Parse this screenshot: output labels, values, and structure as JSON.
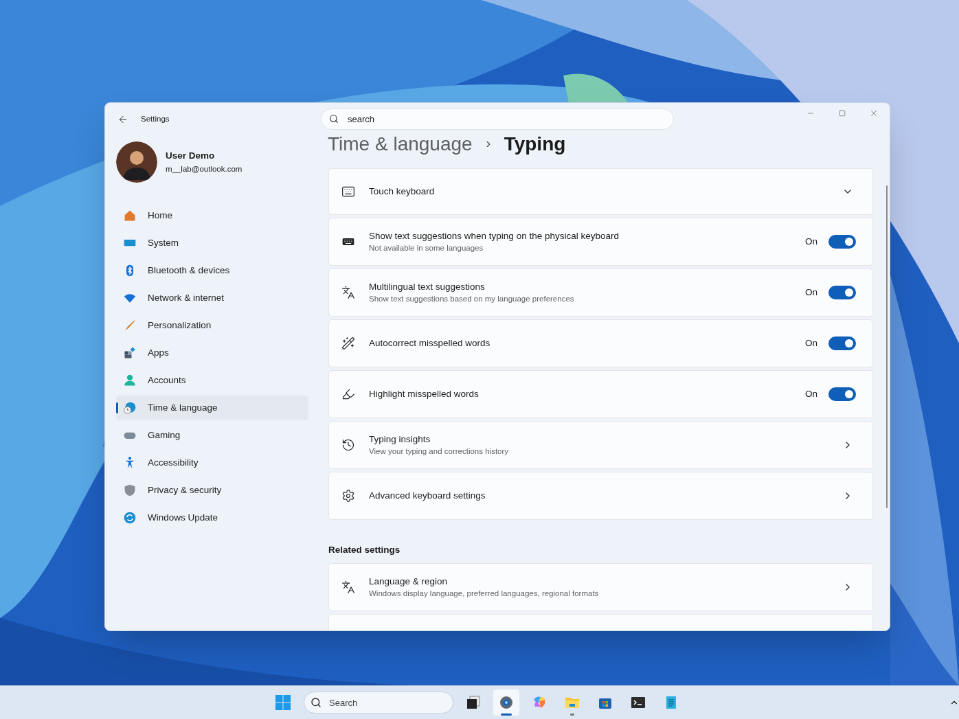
{
  "window": {
    "title": "Settings"
  },
  "search": {
    "placeholder": "search"
  },
  "user": {
    "name": "User Demo",
    "email": "m__lab@outlook.com"
  },
  "nav": [
    {
      "label": "Home",
      "selected": false
    },
    {
      "label": "System",
      "selected": false
    },
    {
      "label": "Bluetooth & devices",
      "selected": false
    },
    {
      "label": "Network & internet",
      "selected": false
    },
    {
      "label": "Personalization",
      "selected": false
    },
    {
      "label": "Apps",
      "selected": false
    },
    {
      "label": "Accounts",
      "selected": false
    },
    {
      "label": "Time & language",
      "selected": true
    },
    {
      "label": "Gaming",
      "selected": false
    },
    {
      "label": "Accessibility",
      "selected": false
    },
    {
      "label": "Privacy & security",
      "selected": false
    },
    {
      "label": "Windows Update",
      "selected": false
    }
  ],
  "breadcrumb": {
    "parent": "Time & language",
    "current": "Typing"
  },
  "settings": [
    {
      "kind": "expander",
      "title": "Touch keyboard"
    },
    {
      "kind": "toggle",
      "title": "Show text suggestions when typing on the physical keyboard",
      "subtitle": "Not available in some languages",
      "state_label": "On",
      "on": true
    },
    {
      "kind": "toggle",
      "title": "Multilingual text suggestions",
      "subtitle": "Show text suggestions based on my language preferences",
      "state_label": "On",
      "on": true
    },
    {
      "kind": "toggle",
      "title": "Autocorrect misspelled words",
      "state_label": "On",
      "on": true
    },
    {
      "kind": "toggle",
      "title": "Highlight misspelled words",
      "state_label": "On",
      "on": true
    },
    {
      "kind": "link",
      "title": "Typing insights",
      "subtitle": "View your typing and corrections history"
    },
    {
      "kind": "link",
      "title": "Advanced keyboard settings"
    }
  ],
  "related": {
    "heading": "Related settings",
    "items": [
      {
        "kind": "link",
        "title": "Language & region",
        "subtitle": "Windows display language, preferred languages, regional formats"
      },
      {
        "kind": "cut"
      }
    ]
  },
  "taskbar": {
    "search_placeholder": "Search",
    "apps": [
      {
        "selected": false,
        "running": false
      },
      {
        "selected": true,
        "running": true
      },
      {
        "selected": false,
        "running": false
      },
      {
        "selected": false,
        "running": true
      },
      {
        "selected": false,
        "running": false
      },
      {
        "selected": false,
        "running": false
      },
      {
        "selected": false,
        "running": false
      }
    ]
  }
}
